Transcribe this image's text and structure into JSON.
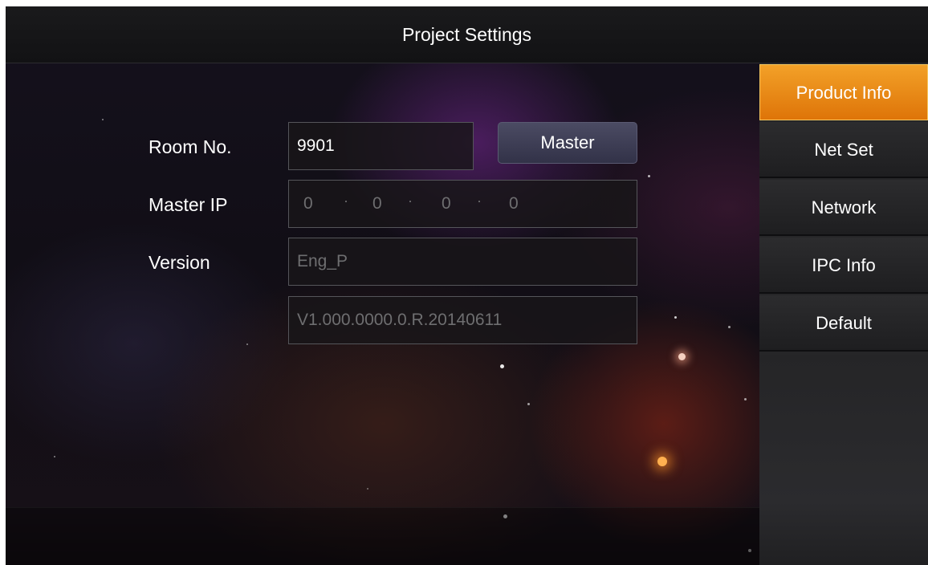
{
  "header": {
    "title": "Project Settings"
  },
  "form": {
    "room_label": "Room No.",
    "room_value": "9901",
    "master_button": "Master",
    "master_ip_label": "Master IP",
    "master_ip": [
      "0",
      "0",
      "0",
      "0"
    ],
    "version_label": "Version",
    "version_value": "Eng_P",
    "build_value": "V1.000.0000.0.R.20140611"
  },
  "sidebar": {
    "items": [
      {
        "label": "Product Info",
        "active": true
      },
      {
        "label": "Net Set",
        "active": false
      },
      {
        "label": "Network",
        "active": false
      },
      {
        "label": "IPC Info",
        "active": false
      },
      {
        "label": "Default",
        "active": false
      }
    ]
  },
  "colors": {
    "accent": "#e88a14",
    "sidebar_bg": "#262628",
    "button_bg": "#3c3c54"
  }
}
